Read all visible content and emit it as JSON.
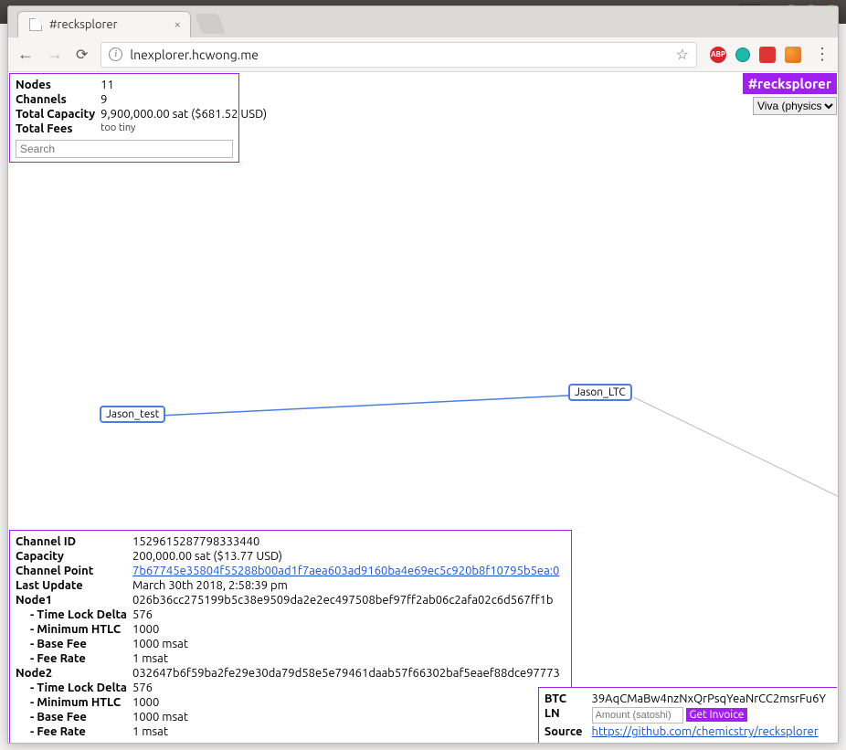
{
  "window": {
    "tab_title": "#recksplorer"
  },
  "addressbar": {
    "url_display": "lnexplorer.hcwong.me"
  },
  "stats": {
    "nodes_label": "Nodes",
    "nodes_value": "11",
    "channels_label": "Channels",
    "channels_value": "9",
    "capacity_label": "Total Capacity",
    "capacity_value": "9,900,000.00 sat ($681.52 USD)",
    "fees_label": "Total Fees",
    "fees_value": "too tiny",
    "search_placeholder": "Search"
  },
  "brand": {
    "title": "#recksplorer",
    "layout_selected": "Viva (physics)"
  },
  "graph": {
    "node_a": "Jason_test",
    "node_b": "Jason_LTC"
  },
  "details": {
    "channel_id_label": "Channel ID",
    "channel_id": "1529615287798333440",
    "capacity_label": "Capacity",
    "capacity": "200,000.00 sat ($13.77 USD)",
    "channel_point_label": "Channel Point",
    "channel_point": "7b67745e35804f55288b00ad1f7aea603ad9160ba4e69ec5c920b8f10795b5ea:0",
    "last_update_label": "Last Update",
    "last_update": "March 30th 2018, 2:58:39 pm",
    "node1_label": "Node1",
    "node1_pub": "026b36cc275199b5c38e9509da2e2ec497508bef97ff2ab06c2afa02c6d567ff1b",
    "node2_label": "Node2",
    "node2_pub": "032647b6f59ba2fe29e30da79d58e5e79461daab57f66302baf5eaef88dce97773",
    "tld_label": "- Time Lock Delta",
    "mhtlc_label": "- Minimum HTLC",
    "bfee_label": "- Base Fee",
    "frate_label": "- Fee Rate",
    "n1_tld": "576",
    "n1_mhtlc": "1000",
    "n1_bfee": "1000 msat",
    "n1_frate": "1 msat",
    "n2_tld": "576",
    "n2_mhtlc": "1000",
    "n2_bfee": "1000 msat",
    "n2_frate": "1 msat"
  },
  "donate": {
    "btc_label": "BTC",
    "btc_addr": "39AqCMaBw4nzNxQrPsqYeaNrCC2msrFu6Y",
    "ln_label": "LN",
    "ln_placeholder": "Amount (satoshi)",
    "ln_button": "Get Invoice",
    "source_label": "Source",
    "source_url": "https://github.com/chemicstry/recksplorer"
  }
}
